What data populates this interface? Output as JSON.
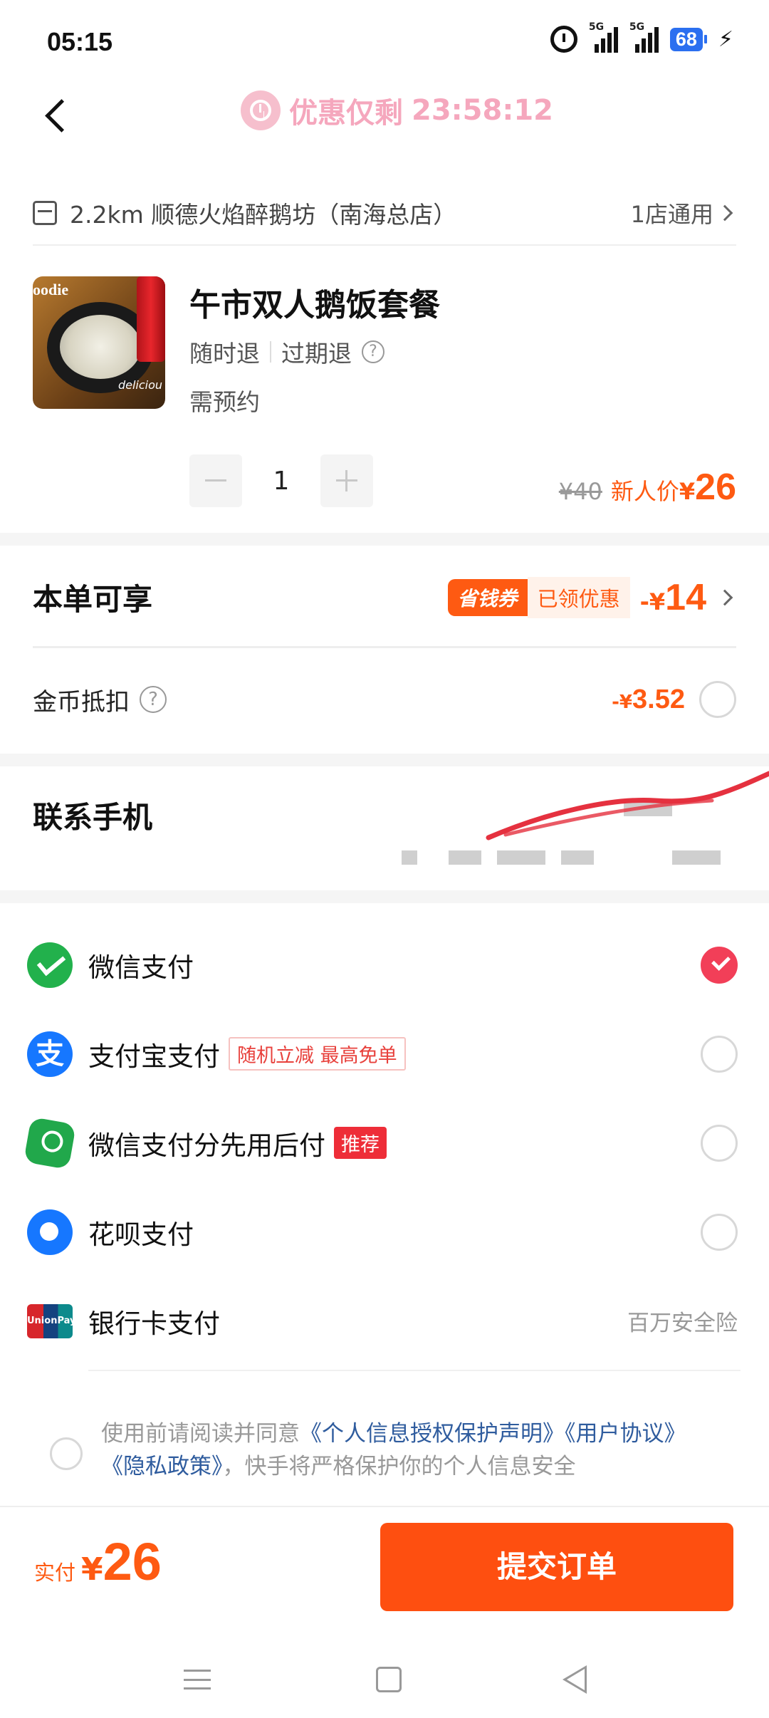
{
  "status_bar": {
    "time": "05:15",
    "battery": "68",
    "network_1": "5G",
    "network_2": "5G"
  },
  "header": {
    "countdown_label": "优惠仅剩",
    "countdown_time": "23:58:12"
  },
  "store": {
    "distance_name": "2.2km 顺德火焰醉鹅坊（南海总店）",
    "scope": "1店通用"
  },
  "product": {
    "image_text_1": "oodie",
    "image_text_2": "deliciou",
    "title": "午市双人鹅饭套餐",
    "tag_refund_anytime": "随时退",
    "tag_refund_expired": "过期退",
    "help_mark": "?",
    "reservation": "需预约",
    "quantity": "1",
    "old_price": "¥40",
    "new_price_label": "新人价",
    "currency": "¥",
    "new_price": "26"
  },
  "discount": {
    "title": "本单可享",
    "coupon_badge": "省钱券",
    "coupon_status": "已领优惠",
    "minus_prefix": "-¥",
    "minus_amount": "14"
  },
  "coins": {
    "label": "金币抵扣",
    "minus_prefix": "-¥",
    "amount": "3.52"
  },
  "contact": {
    "title": "联系手机"
  },
  "payment_methods": [
    {
      "label": "微信支付",
      "selected": true
    },
    {
      "label": "支付宝支付",
      "promo": "随机立减 最高免单",
      "icon_text": "支"
    },
    {
      "label": "微信支付分先用后付",
      "badge": "推荐"
    },
    {
      "label": "花呗支付"
    },
    {
      "label": "银行卡支付",
      "note": "百万安全险",
      "icon_text": "UnionPay 银联"
    }
  ],
  "agreement": {
    "prefix": "使用前请阅读并同意",
    "link_privacy_auth": "《个人信息授权保护声明》",
    "link_user_agreement": "《用户协议》",
    "link_privacy_policy": "《隐私政策》",
    "suffix": "，快手将严格保护你的个人信息安全"
  },
  "bottom": {
    "pay_label": "实付",
    "currency": "¥",
    "amount": "26",
    "submit": "提交订单"
  },
  "colors": {
    "accent": "#fe5a12",
    "submit_bg": "#fe4f10",
    "selected_radio": "#f23f58",
    "link": "#2f5c9e",
    "countdown": "#f5a7bd"
  }
}
